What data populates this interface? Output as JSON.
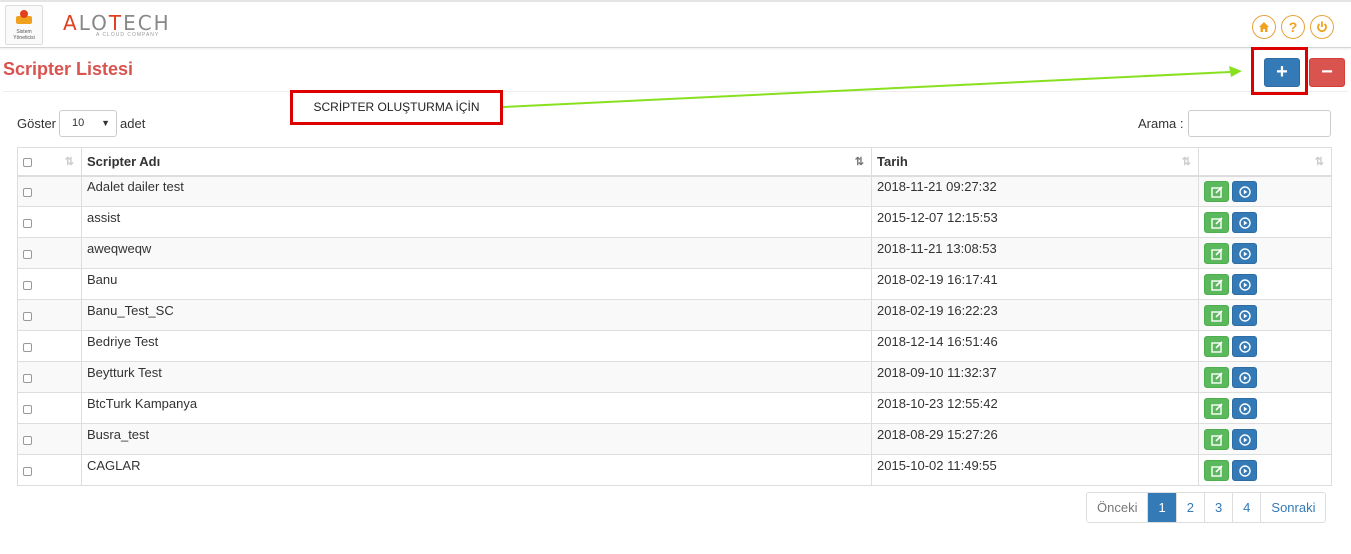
{
  "header": {
    "sys_logo_line1": "Sistem",
    "sys_logo_line2": "Yöneticisi",
    "brand_name_part1": "A",
    "brand_name_part2": "LO",
    "brand_name_part3": "T",
    "brand_name_part4": "ECH",
    "brand_tagline": "A CLOUD COMPANY",
    "icons": [
      "home-icon",
      "help-icon",
      "power-icon"
    ],
    "help_glyph": "?"
  },
  "page": {
    "title": "Scripter Listesi",
    "add_glyph": "+",
    "remove_glyph": "−",
    "annotation": "SCRİPTER OLUŞTURMA İÇİN"
  },
  "controls": {
    "show_label": "Göster",
    "page_size": "10",
    "per_label": "adet",
    "search_label": "Arama :",
    "search_value": ""
  },
  "table": {
    "columns": [
      "",
      "Scripter Adı",
      "Tarih",
      ""
    ],
    "rows": [
      {
        "name": "Adalet dailer test",
        "date": "2018-11-21 09:27:32"
      },
      {
        "name": "assist",
        "date": "2015-12-07 12:15:53"
      },
      {
        "name": "aweqweqw",
        "date": "2018-11-21 13:08:53"
      },
      {
        "name": "Banu",
        "date": "2018-02-19 16:17:41"
      },
      {
        "name": "Banu_Test_SC",
        "date": "2018-02-19 16:22:23"
      },
      {
        "name": "Bedriye Test",
        "date": "2018-12-14 16:51:46"
      },
      {
        "name": "Beytturk Test",
        "date": "2018-09-10 11:32:37"
      },
      {
        "name": "BtcTurk Kampanya",
        "date": "2018-10-23 12:55:42"
      },
      {
        "name": "Busra_test",
        "date": "2018-08-29 15:27:26"
      },
      {
        "name": "CAGLAR",
        "date": "2015-10-02 11:49:55"
      }
    ]
  },
  "pagination": {
    "prev": "Önceki",
    "pages": [
      "1",
      "2",
      "3",
      "4"
    ],
    "current": "1",
    "next": "Sonraki"
  },
  "colors": {
    "title_red": "#d9534f",
    "primary_blue": "#337ab7",
    "success_green": "#5cb85c",
    "danger_red": "#d9534f",
    "annotation_red": "#dd0000",
    "arrow_green": "#88e01f",
    "accent_orange": "#f0a21f"
  }
}
